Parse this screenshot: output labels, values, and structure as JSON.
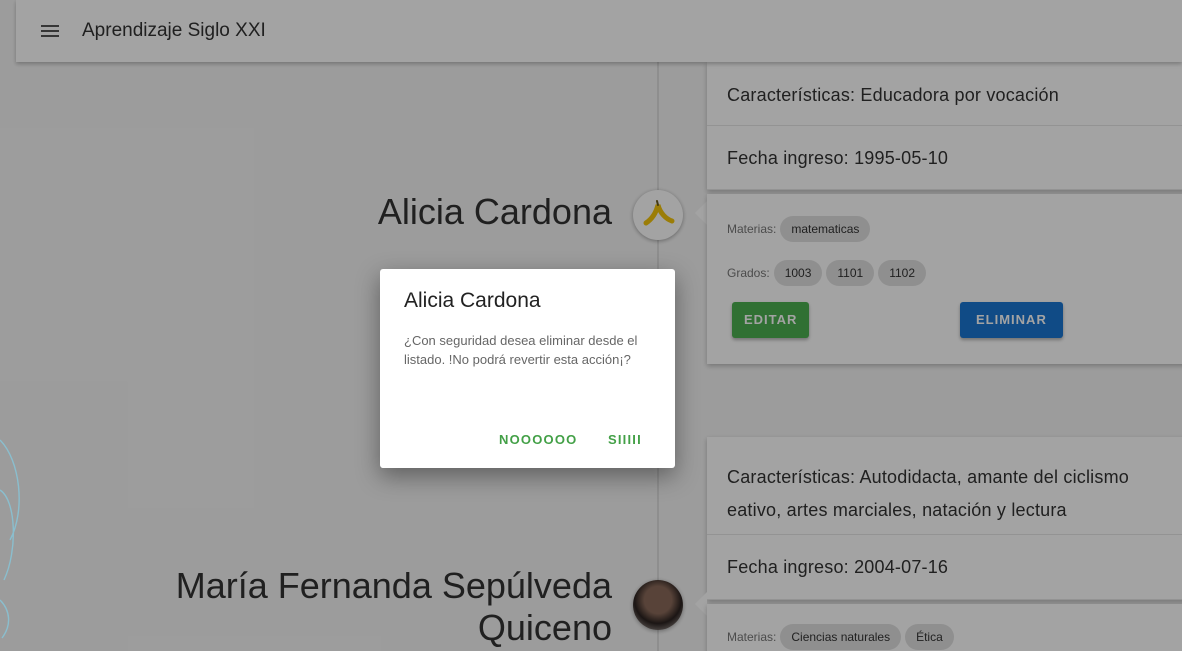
{
  "app": {
    "title": "Aprendizaje Siglo XXI",
    "menu_icon": "hamburger-menu-icon"
  },
  "teachers": [
    {
      "name": "Alicia Cardona",
      "avatar_icon": "banana-avatar-icon",
      "caracteristicas": "Características: Educadora por vocación",
      "fecha_ingreso": "Fecha ingreso: 1995-05-10",
      "materias_label": "Materias:",
      "materias": [
        "matematicas"
      ],
      "grados_label": "Grados:",
      "grados": [
        "1003",
        "1101",
        "1102"
      ],
      "edit_label": "EDITAR",
      "delete_label": "ELIMINAR"
    },
    {
      "name_line1": "María Fernanda Sepúlveda",
      "name_line2": "Quiceno",
      "avatar_icon": "photo-avatar-icon",
      "caracteristicas_line1": "Características: Autodidacta, amante del ciclismo",
      "caracteristicas_line2": "eativo, artes marciales, natación y lectura",
      "fecha_ingreso": "Fecha ingreso: 2004-07-16",
      "materias_label": "Materias:",
      "materias": [
        "Ciencias naturales",
        "Ética"
      ]
    }
  ],
  "dialog": {
    "title": "Alicia Cardona",
    "message": "¿Con seguridad desea eliminar desde el listado. !No podrá revertir esta acción¡?",
    "cancel_label": "NOOOOOO",
    "confirm_label": "SIIIII"
  },
  "colors": {
    "edit_button": "#4caf50",
    "delete_button": "#1976d2",
    "dialog_action": "#43a047",
    "overlay": "rgba(0,0,0,0.36)"
  }
}
